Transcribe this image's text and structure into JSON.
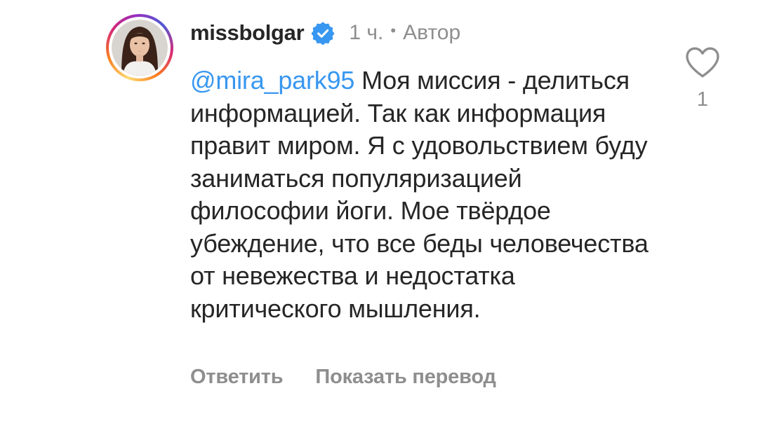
{
  "comment": {
    "username": "missbolgar",
    "verified_icon": "verified-badge-icon",
    "time": "1 ч.",
    "separator": "•",
    "author_label": "Автор",
    "mention": "@mira_park95",
    "text": "Моя миссия - делиться информацией. Так как информация правит миром. Я с удовольствием буду заниматься популяризацией философии йоги. Мое твёрдое убеждение, что все беды человечества от невежества и недостатка критического мышления.",
    "like_count": "1"
  },
  "actions": {
    "reply_label": "Ответить",
    "translate_label": "Показать перевод"
  },
  "icons": {
    "like": "heart-icon"
  },
  "colors": {
    "mention": "#3897f0",
    "verified": "#3897f0",
    "muted": "#8e8e8e",
    "text": "#262626"
  }
}
